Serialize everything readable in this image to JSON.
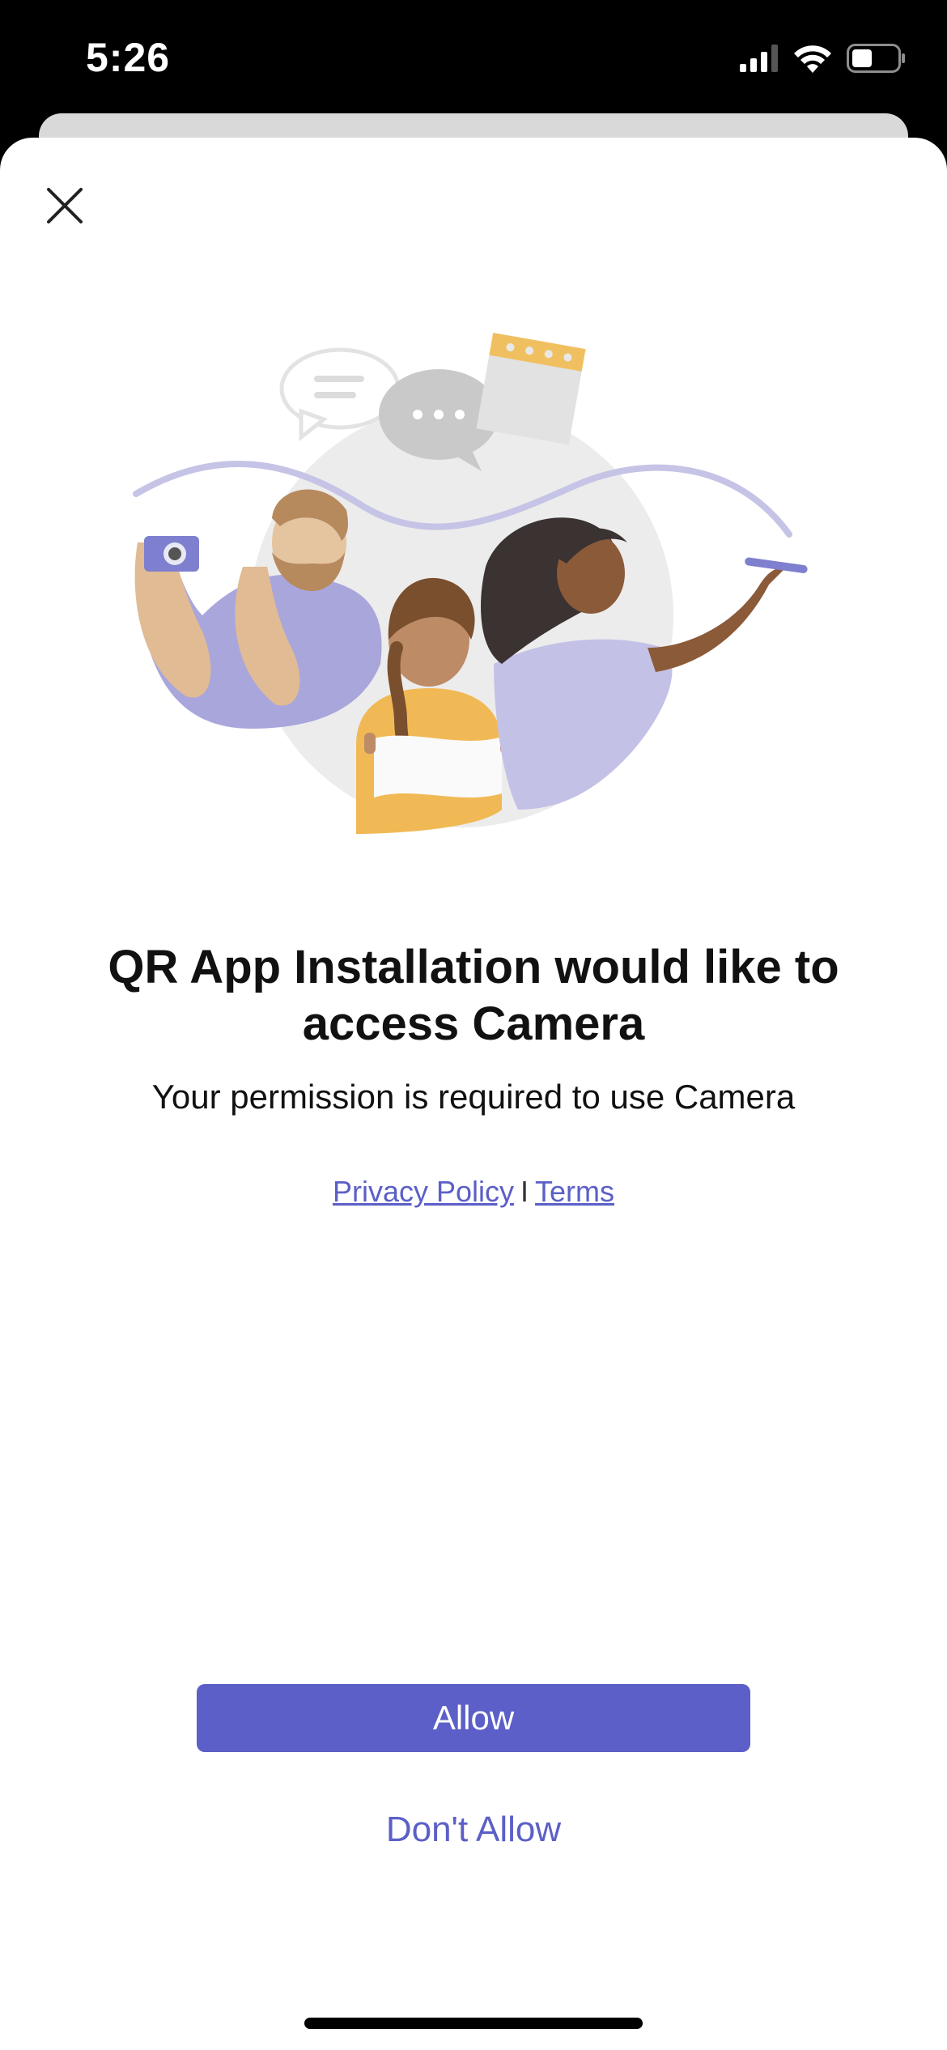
{
  "status_bar": {
    "time": "5:26",
    "icons": [
      "cellular-signal-icon",
      "wifi-icon",
      "battery-icon"
    ]
  },
  "dialog": {
    "title": "QR App Installation would like to access Camera",
    "subtitle": "Your permission is required to use Camera",
    "links": {
      "privacy_label": "Privacy Policy",
      "separator": "I",
      "terms_label": "Terms"
    },
    "allow_label": "Allow",
    "deny_label": "Don't Allow",
    "illustration": "people-collaboration-illustration"
  },
  "colors": {
    "accent": "#5b5fc7",
    "background": "#ffffff",
    "status_bar": "#000000"
  }
}
